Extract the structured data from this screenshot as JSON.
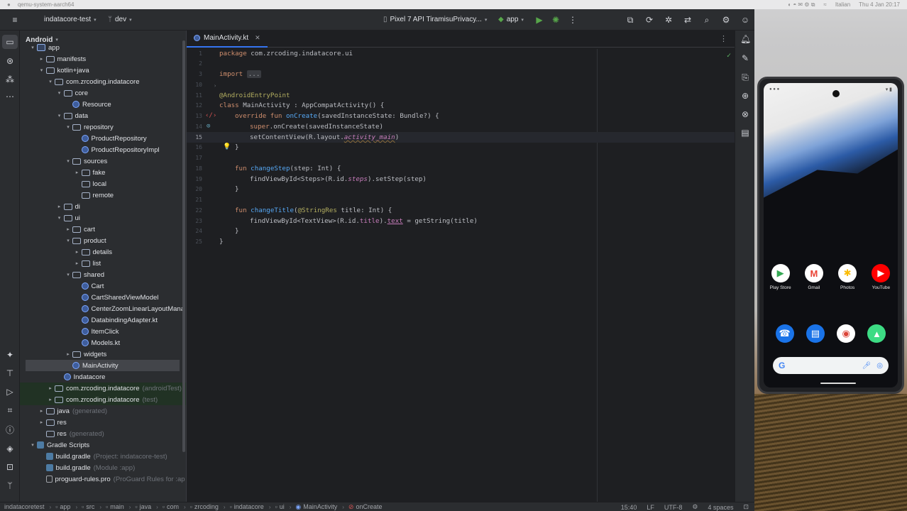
{
  "macbar": {
    "app_title": "qemu-system-aarch64",
    "lang": "Italian",
    "datetime": "Thu 4 Jan 20:17"
  },
  "toolbar": {
    "project": "indatacore-test",
    "branch": "dev",
    "device": "Pixel 7 API TiramisuPrivacy...",
    "run_config": "app"
  },
  "project_panel": {
    "view": "Android",
    "rows": [
      {
        "label": "app",
        "suffix": "",
        "indent": 0,
        "arrow": "▾",
        "icon": "module"
      },
      {
        "label": "manifests",
        "suffix": "",
        "indent": 1,
        "arrow": "▸",
        "icon": "folder"
      },
      {
        "label": "kotlin+java",
        "suffix": "",
        "indent": 1,
        "arrow": "▾",
        "icon": "folder"
      },
      {
        "label": "com.zrcoding.indatacore",
        "suffix": "",
        "indent": 2,
        "arrow": "▾",
        "icon": "folder"
      },
      {
        "label": "core",
        "suffix": "",
        "indent": 3,
        "arrow": "▾",
        "icon": "folder"
      },
      {
        "label": "Resource",
        "suffix": "",
        "indent": 4,
        "arrow": "",
        "icon": "kt"
      },
      {
        "label": "data",
        "suffix": "",
        "indent": 3,
        "arrow": "▾",
        "icon": "folder"
      },
      {
        "label": "repository",
        "suffix": "",
        "indent": 4,
        "arrow": "▾",
        "icon": "folder"
      },
      {
        "label": "ProductRepository",
        "suffix": "",
        "indent": 5,
        "arrow": "",
        "icon": "kt"
      },
      {
        "label": "ProductRepositoryImpl",
        "suffix": "",
        "indent": 5,
        "arrow": "",
        "icon": "kt"
      },
      {
        "label": "sources",
        "suffix": "",
        "indent": 4,
        "arrow": "▾",
        "icon": "folder"
      },
      {
        "label": "fake",
        "suffix": "",
        "indent": 5,
        "arrow": "▸",
        "icon": "folder"
      },
      {
        "label": "local",
        "suffix": "",
        "indent": 5,
        "arrow": "",
        "icon": "folder"
      },
      {
        "label": "remote",
        "suffix": "",
        "indent": 5,
        "arrow": "",
        "icon": "folder"
      },
      {
        "label": "di",
        "suffix": "",
        "indent": 3,
        "arrow": "▸",
        "icon": "folder"
      },
      {
        "label": "ui",
        "suffix": "",
        "indent": 3,
        "arrow": "▾",
        "icon": "folder"
      },
      {
        "label": "cart",
        "suffix": "",
        "indent": 4,
        "arrow": "▸",
        "icon": "folder"
      },
      {
        "label": "product",
        "suffix": "",
        "indent": 4,
        "arrow": "▾",
        "icon": "folder"
      },
      {
        "label": "details",
        "suffix": "",
        "indent": 5,
        "arrow": "▸",
        "icon": "folder"
      },
      {
        "label": "list",
        "suffix": "",
        "indent": 5,
        "arrow": "▸",
        "icon": "folder"
      },
      {
        "label": "shared",
        "suffix": "",
        "indent": 4,
        "arrow": "▾",
        "icon": "folder"
      },
      {
        "label": "Cart",
        "suffix": "",
        "indent": 5,
        "arrow": "",
        "icon": "kt"
      },
      {
        "label": "CartSharedViewModel",
        "suffix": "",
        "indent": 5,
        "arrow": "",
        "icon": "kt"
      },
      {
        "label": "CenterZoomLinearLayoutMana",
        "suffix": "",
        "indent": 5,
        "arrow": "",
        "icon": "kt"
      },
      {
        "label": "DatabindingAdapter.kt",
        "suffix": "",
        "indent": 5,
        "arrow": "",
        "icon": "kt"
      },
      {
        "label": "ItemClick",
        "suffix": "",
        "indent": 5,
        "arrow": "",
        "icon": "kt"
      },
      {
        "label": "Models.kt",
        "suffix": "",
        "indent": 5,
        "arrow": "",
        "icon": "kt"
      },
      {
        "label": "widgets",
        "suffix": "",
        "indent": 4,
        "arrow": "▸",
        "icon": "folder"
      },
      {
        "label": "MainActivity",
        "suffix": "",
        "indent": 4,
        "arrow": "",
        "icon": "kt",
        "selected": true
      },
      {
        "label": "Indatacore",
        "suffix": "",
        "indent": 3,
        "arrow": "",
        "icon": "kt"
      },
      {
        "label": "com.zrcoding.indatacore",
        "suffix": "(androidTest)",
        "indent": 2,
        "arrow": "▸",
        "icon": "folder",
        "test": true
      },
      {
        "label": "com.zrcoding.indatacore",
        "suffix": "(test)",
        "indent": 2,
        "arrow": "▸",
        "icon": "folder",
        "test": true
      },
      {
        "label": "java",
        "suffix": "(generated)",
        "indent": 1,
        "arrow": "▸",
        "icon": "folder"
      },
      {
        "label": "res",
        "suffix": "",
        "indent": 1,
        "arrow": "▸",
        "icon": "folder"
      },
      {
        "label": "res",
        "suffix": "(generated)",
        "indent": 1,
        "arrow": "",
        "icon": "folder"
      },
      {
        "label": "Gradle Scripts",
        "suffix": "",
        "indent": 0,
        "arrow": "▾",
        "icon": "grad"
      },
      {
        "label": "build.gradle",
        "suffix": "(Project: indatacore-test)",
        "indent": 1,
        "arrow": "",
        "icon": "grad"
      },
      {
        "label": "build.gradle",
        "suffix": "(Module :app)",
        "indent": 1,
        "arrow": "",
        "icon": "grad"
      },
      {
        "label": "proguard-rules.pro",
        "suffix": "(ProGuard Rules for :ap",
        "indent": 1,
        "arrow": "",
        "icon": "file"
      }
    ]
  },
  "editor": {
    "tab": "MainActivity.kt",
    "line_numbers": [
      "1",
      "2",
      "3",
      "10",
      "11",
      "12",
      "13",
      "14",
      "15",
      "16",
      "17",
      "18",
      "19",
      "20",
      "21",
      "22",
      "23",
      "24",
      "25"
    ],
    "current_line": "15"
  },
  "code": {
    "l1_kw": "package",
    "l1_rest": " com.zrcoding.indatacore.ui",
    "l3_kw": "import",
    "l3_fold": "...",
    "l10": "@AndroidEntryPoint",
    "l11_kw": "class",
    "l11_rest": " MainActivity : AppCompatActivity() {",
    "l12_kw": "override fun",
    "l12_fn": "onCreate",
    "l12_rest": "(savedInstanceState: Bundle?) {",
    "l13_kw": "super",
    "l13_rest": ".onCreate(savedInstanceState)",
    "l14_a": "setContentView(R.layout.",
    "l14_b": "activity_main",
    "l14_c": ")",
    "l15": "}",
    "l17_kw": "fun",
    "l17_fn": "changeStep",
    "l17_rest": "(step: Int) {",
    "l18_a": "findViewById<Steps>(R.id.",
    "l18_b": "steps",
    "l18_c": ").setStep(step)",
    "l19": "}",
    "l21_kw": "fun",
    "l21_fn": "changeTitle",
    "l21_ann": "@StringRes",
    "l21_rest": " title: Int) {",
    "l22_a": "findViewById<TextView>(R.id.",
    "l22_b": "title",
    "l22_c": ").",
    "l22_d": "text",
    "l22_e": " = getString(title)",
    "l23": "}",
    "l24": "}"
  },
  "statusbar": {
    "crumbs": [
      "indatacoretest",
      "app",
      "src",
      "main",
      "java",
      "com",
      "zrcoding",
      "indatacore",
      "ui",
      "MainActivity",
      "onCreate"
    ],
    "position": "15:40",
    "line_sep": "LF",
    "encoding": "UTF-8",
    "indent": "4 spaces"
  },
  "phone": {
    "apps": [
      {
        "label": "Play Store",
        "glyph": "▶",
        "bg": "#ffffff",
        "fg": "#34a853"
      },
      {
        "label": "Gmail",
        "glyph": "M",
        "bg": "#ffffff",
        "fg": "#ea4335"
      },
      {
        "label": "Photos",
        "glyph": "✱",
        "bg": "#ffffff",
        "fg": "#fbbc05"
      },
      {
        "label": "YouTube",
        "glyph": "▶",
        "bg": "#ff0000",
        "fg": "#ffffff"
      }
    ],
    "dock": [
      {
        "glyph": "☎",
        "bg": "#1a73e8",
        "fg": "#ffffff"
      },
      {
        "glyph": "▤",
        "bg": "#1a73e8",
        "fg": "#ffffff"
      },
      {
        "glyph": "◉",
        "bg": "#ffffff",
        "fg": "#db4437"
      },
      {
        "glyph": "▲",
        "bg": "#3ddc84",
        "fg": "#ffffff"
      }
    ],
    "search_logo": "G"
  }
}
